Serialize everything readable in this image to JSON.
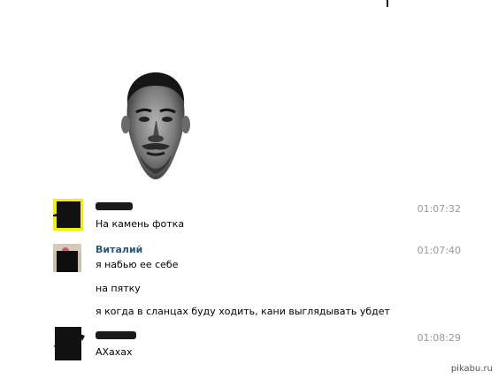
{
  "portrait": {
    "icon": "face-portrait"
  },
  "messages": [
    {
      "author": "",
      "time": "01:07:32",
      "lines": [
        "На камень фотка"
      ]
    },
    {
      "author": "Виталий",
      "time": "01:07:40",
      "lines": [
        "я набью ее себе",
        "на пятку",
        "я когда в сланцах буду ходить, кани выглядывать убдет"
      ]
    },
    {
      "author": "",
      "time": "01:08:29",
      "lines": [
        "АХахах"
      ]
    }
  ],
  "watermark": "pikabu.ru",
  "colors": {
    "author": "#2b587a",
    "time": "#999999",
    "highlight": "#f5f000"
  }
}
